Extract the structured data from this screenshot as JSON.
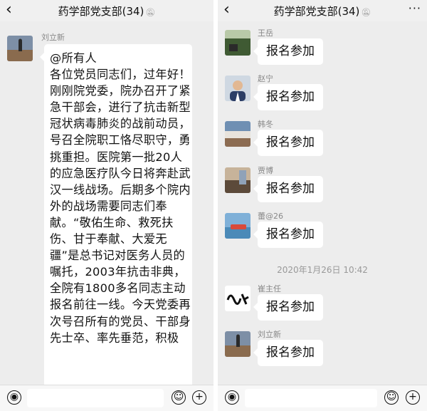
{
  "left": {
    "title": "药学部党支部(34)",
    "back_icon": "‹",
    "sender": "刘立新",
    "message": "@所有人\n各位党员同志们，过年好！刚刚院党委，院办召开了紧急干部会，进行了抗击新型冠状病毒肺炎的战前动员，号召全院职工恪尽职守，勇挑重担。医院第一批20人的应急医疗队今日将奔赴武汉一线战场。后期多个院内外的战场需要同志们奉献。“敬佑生命、救死扶伤、甘于奉献、大爱无疆”是总书记对医务人员的嘱托，2003年抗击非典，全院有1800多名同志主动报名前往一线。今天党委再次号召所有的党员、干部身先士卒、率先垂范，积极"
  },
  "right": {
    "title": "药学部党支部(34)",
    "back_icon": "‹",
    "more_icon": "···",
    "messages": [
      {
        "name": "王岳",
        "text": "报名参加"
      },
      {
        "name": "赵宁",
        "text": "报名参加"
      },
      {
        "name": "韩冬",
        "text": "报名参加"
      },
      {
        "name": "贾博",
        "text": "报名参加"
      },
      {
        "name": "蕾@26",
        "text": "报名参加"
      },
      {
        "name": "崔主任",
        "text": "报名参加"
      },
      {
        "name": "刘立新",
        "text": "报名参加"
      }
    ],
    "timestamp": "2020年1月26日 10:42"
  },
  "icons": {
    "mute": "bell-off-icon",
    "voice": "voice-icon",
    "emoji": "emoji-icon",
    "plus": "plus-icon"
  }
}
